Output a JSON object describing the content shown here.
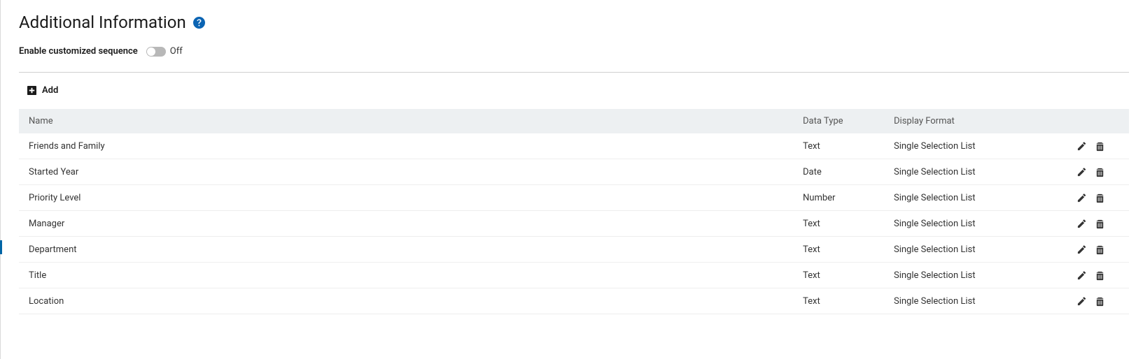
{
  "header": {
    "title": "Additional Information"
  },
  "toggle": {
    "label": "Enable customized sequence",
    "state": "Off"
  },
  "actions": {
    "add_label": "Add"
  },
  "table": {
    "columns": {
      "name": "Name",
      "data_type": "Data Type",
      "display_format": "Display Format"
    },
    "rows": [
      {
        "name": "Friends and Family",
        "data_type": "Text",
        "display_format": "Single Selection List"
      },
      {
        "name": "Started Year",
        "data_type": "Date",
        "display_format": "Single Selection List"
      },
      {
        "name": "Priority Level",
        "data_type": "Number",
        "display_format": "Single Selection List"
      },
      {
        "name": "Manager",
        "data_type": "Text",
        "display_format": "Single Selection List"
      },
      {
        "name": "Department",
        "data_type": "Text",
        "display_format": "Single Selection List"
      },
      {
        "name": "Title",
        "data_type": "Text",
        "display_format": "Single Selection List"
      },
      {
        "name": "Location",
        "data_type": "Text",
        "display_format": "Single Selection List"
      }
    ]
  }
}
